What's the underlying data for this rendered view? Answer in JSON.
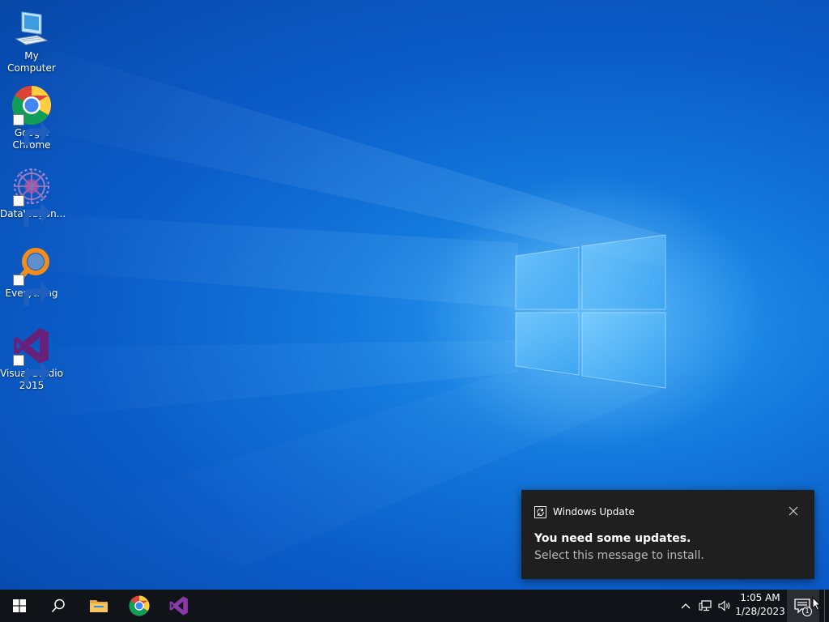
{
  "desktop": {
    "icons": [
      {
        "label": "My Computer",
        "icon": "computer-icon"
      },
      {
        "label": "Google Chrome",
        "icon": "chrome-icon"
      },
      {
        "label": "DataWagon...",
        "icon": "datawagon-icon"
      },
      {
        "label": "Everything",
        "icon": "everything-search-icon"
      },
      {
        "label": "Visual Studio 2015",
        "icon": "visual-studio-icon"
      }
    ],
    "wallpaper": "windows-10-hero"
  },
  "toast": {
    "app_name": "Windows Update",
    "title": "You need some updates.",
    "body": "Select this message to install.",
    "app_icon": "update-sync-icon",
    "close_icon": "close-icon"
  },
  "taskbar": {
    "items": [
      {
        "name": "start",
        "icon": "windows-logo-icon"
      },
      {
        "name": "search",
        "icon": "search-icon"
      },
      {
        "name": "file-explorer",
        "icon": "folder-icon"
      },
      {
        "name": "chrome",
        "icon": "chrome-icon"
      },
      {
        "name": "visual-studio",
        "icon": "visual-studio-icon"
      }
    ],
    "tray": {
      "icons": [
        "chevron-up-icon",
        "network-icon",
        "volume-icon"
      ],
      "time": "1:05 AM",
      "date": "1/28/2023",
      "notification_count": "1"
    }
  },
  "colors": {
    "taskbar_bg": "#101317",
    "toast_bg": "#1f1f1f",
    "vs_purple": "#68217a",
    "everything_orange": "#f28c1b"
  }
}
